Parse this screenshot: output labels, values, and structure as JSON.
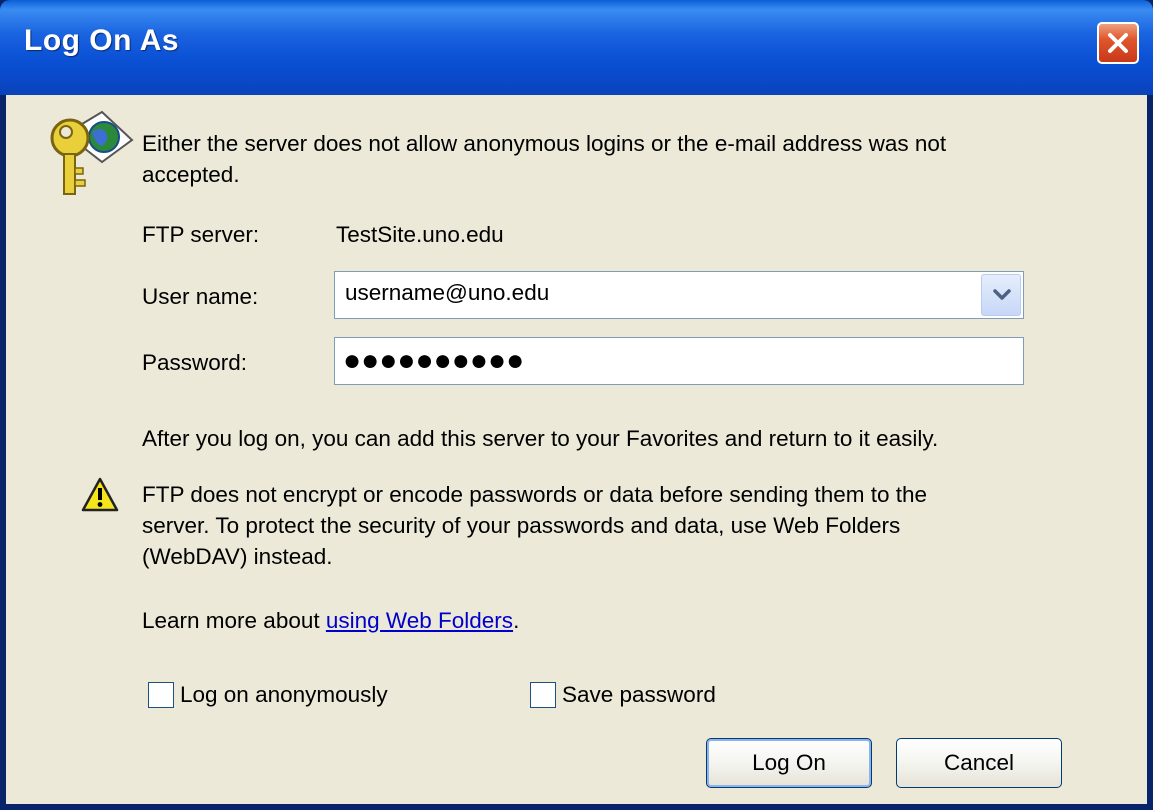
{
  "window": {
    "title": "Log On As"
  },
  "message": {
    "intro": "Either the server does not allow anonymous logins or the e-mail address was not",
    "intro_line2": "accepted."
  },
  "form": {
    "ftp_server_label": "FTP server:",
    "ftp_server_value": "TestSite.uno.edu",
    "user_name_label": "User name:",
    "user_name_value": "username@uno.edu",
    "password_label": "Password:",
    "password_value": "●●●●●●●●●●"
  },
  "favorites_note": "After you log on, you can add this server to your Favorites and return to it easily.",
  "warning": {
    "line1": "FTP does not encrypt or encode passwords or data before sending them to the",
    "line2": "server.  To protect the security of your passwords and data, use Web Folders",
    "line3": "(WebDAV) instead."
  },
  "learn_more": {
    "prefix": "Learn more about ",
    "link_text": "using Web Folders",
    "suffix": "."
  },
  "options": {
    "anonymous_label": "Log on anonymously",
    "anonymous_checked": false,
    "save_password_label": "Save password",
    "save_password_checked": false
  },
  "buttons": {
    "log_on": "Log On",
    "cancel": "Cancel"
  },
  "colors": {
    "titlebar": "#0a48c8",
    "client": "#ece9d8",
    "link": "#0000cc",
    "close": "#e0562c"
  },
  "icons": [
    "key-globe-icon",
    "warning-icon",
    "close-icon",
    "dropdown-arrow-icon"
  ]
}
